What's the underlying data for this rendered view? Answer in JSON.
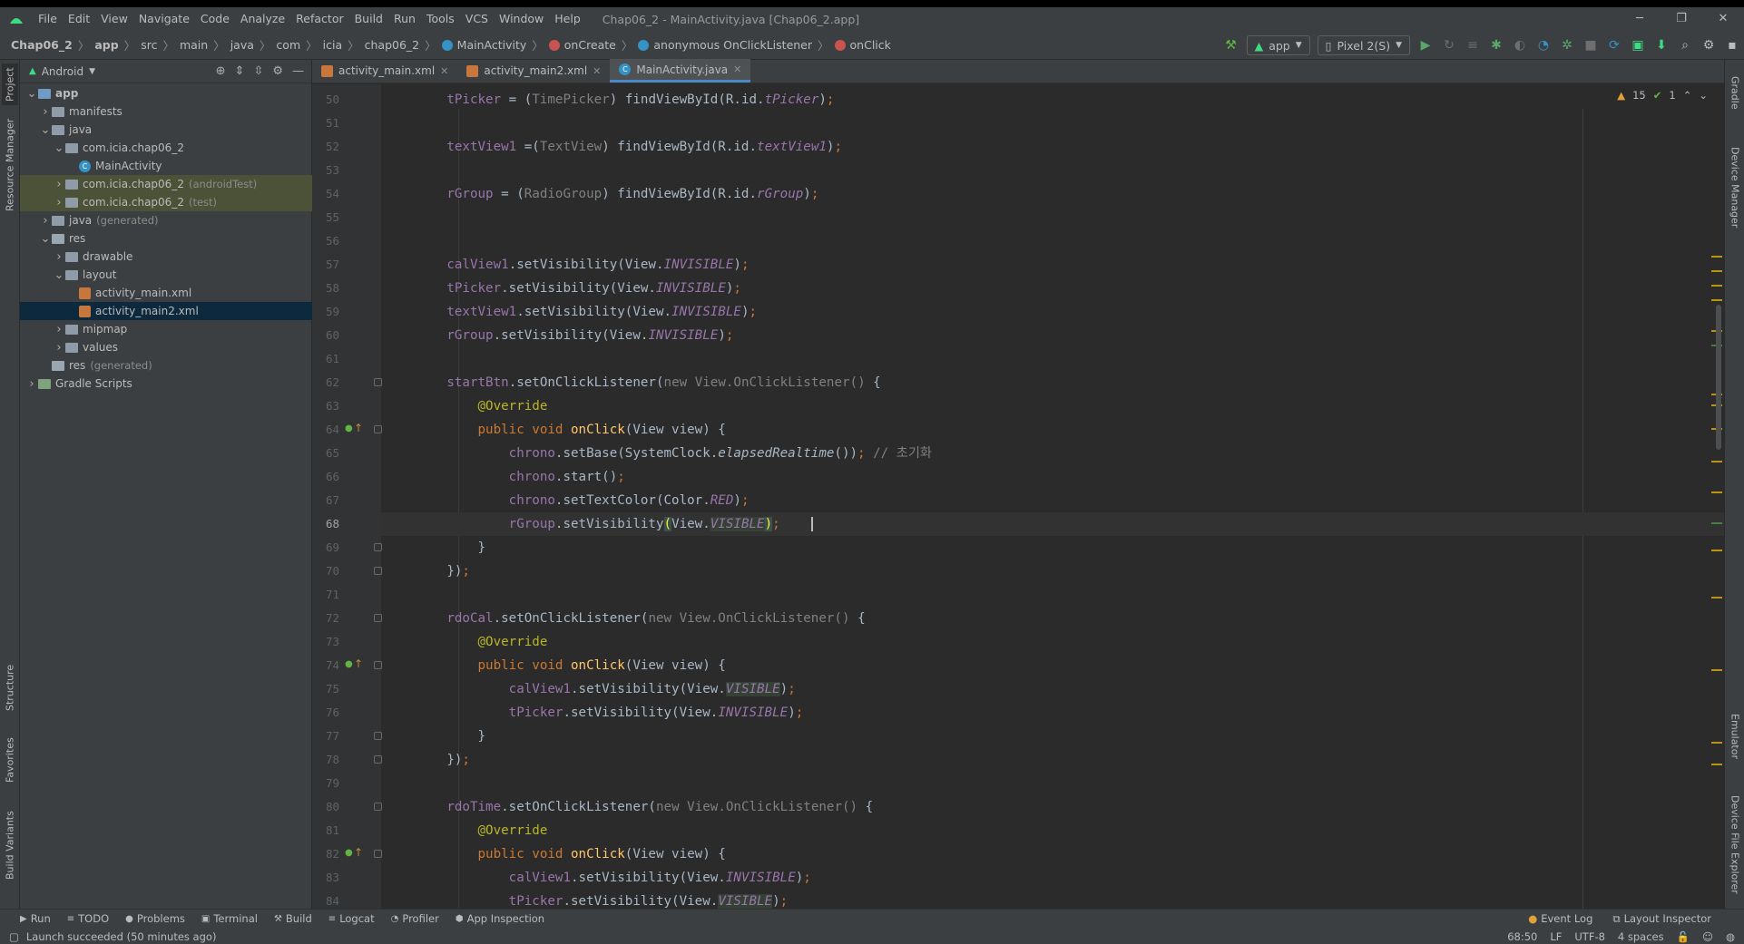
{
  "window": {
    "title": "Chap06_2 - MainActivity.java [Chap06_2.app]",
    "menu": [
      "File",
      "Edit",
      "View",
      "Navigate",
      "Code",
      "Analyze",
      "Refactor",
      "Build",
      "Run",
      "Tools",
      "VCS",
      "Window",
      "Help"
    ],
    "controls": [
      "─",
      "❐",
      "✕"
    ]
  },
  "breadcrumb": [
    "Chap06_2",
    "app",
    "src",
    "main",
    "java",
    "com",
    "icia",
    "chap06_2",
    "MainActivity",
    "onCreate",
    "anonymous OnClickListener",
    "onClick"
  ],
  "toolbar": {
    "config": "app",
    "device": "Pixel 2(S)"
  },
  "left_strip": [
    "Project",
    "Resource Manager",
    "Structure",
    "Favorites",
    "Build Variants"
  ],
  "right_strip": [
    "Gradle",
    "Device Manager",
    "Emulator",
    "Device File Explorer"
  ],
  "project_panel": {
    "view": "Android",
    "tree": [
      {
        "label": "app",
        "depth": 0,
        "arrow": "▼",
        "icon": "folder-blue",
        "bold": true
      },
      {
        "label": "manifests",
        "depth": 1,
        "arrow": "▶",
        "icon": "folder"
      },
      {
        "label": "java",
        "depth": 1,
        "arrow": "▼",
        "icon": "folder"
      },
      {
        "label": "com.icia.chap06_2",
        "depth": 2,
        "arrow": "▼",
        "icon": "folder"
      },
      {
        "label": "MainActivity",
        "depth": 3,
        "arrow": "",
        "icon": "class"
      },
      {
        "label": "com.icia.chap06_2",
        "suffix": "(androidTest)",
        "depth": 2,
        "arrow": "▶",
        "icon": "folder",
        "state": "mod"
      },
      {
        "label": "com.icia.chap06_2",
        "suffix": "(test)",
        "depth": 2,
        "arrow": "▶",
        "icon": "folder",
        "state": "mod"
      },
      {
        "label": "java",
        "suffix": "(generated)",
        "depth": 1,
        "arrow": "▶",
        "icon": "folder"
      },
      {
        "label": "res",
        "depth": 1,
        "arrow": "▼",
        "icon": "folder-res"
      },
      {
        "label": "drawable",
        "depth": 2,
        "arrow": "▶",
        "icon": "folder"
      },
      {
        "label": "layout",
        "depth": 2,
        "arrow": "▼",
        "icon": "folder"
      },
      {
        "label": "activity_main.xml",
        "depth": 3,
        "arrow": "",
        "icon": "xml"
      },
      {
        "label": "activity_main2.xml",
        "depth": 3,
        "arrow": "",
        "icon": "xml",
        "state": "sel"
      },
      {
        "label": "mipmap",
        "depth": 2,
        "arrow": "▶",
        "icon": "folder"
      },
      {
        "label": "values",
        "depth": 2,
        "arrow": "▶",
        "icon": "folder"
      },
      {
        "label": "res",
        "suffix": "(generated)",
        "depth": 1,
        "arrow": "",
        "icon": "folder-res"
      },
      {
        "label": "Gradle Scripts",
        "depth": 0,
        "arrow": "▶",
        "icon": "gradle"
      }
    ]
  },
  "tabs": [
    {
      "label": "activity_main.xml",
      "icon": "xml",
      "active": false
    },
    {
      "label": "activity_main2.xml",
      "icon": "xml",
      "active": false
    },
    {
      "label": "MainActivity.java",
      "icon": "class",
      "active": true
    }
  ],
  "inspections": {
    "warnings": "15",
    "ok": "1"
  },
  "current_line": 68,
  "code": [
    {
      "n": 50,
      "html": "        <span class='f'>tPicker</span> = (<span class='gr'>TimePicker</span>) findViewById(R.id.<span class='fi'>tPicker</span>)<span class='kw'>;</span>"
    },
    {
      "n": 51,
      "html": ""
    },
    {
      "n": 52,
      "html": "        <span class='f'>textView1</span> =(<span class='gr'>TextView</span>) findViewById(R.id.<span class='fi'>textView1</span>)<span class='kw'>;</span>"
    },
    {
      "n": 53,
      "html": ""
    },
    {
      "n": 54,
      "html": "        <span class='f'>rGroup</span> = (<span class='gr'>RadioGroup</span>) findViewById(R.id.<span class='fi'>rGroup</span>)<span class='kw'>;</span>"
    },
    {
      "n": 55,
      "html": ""
    },
    {
      "n": 56,
      "html": ""
    },
    {
      "n": 57,
      "html": "        <span class='f'>calView1</span>.setVisibility(View.<span class='fi'>INVISIBLE</span>)<span class='kw'>;</span>"
    },
    {
      "n": 58,
      "html": "        <span class='f'>tPicker</span>.setVisibility(View.<span class='fi'>INVISIBLE</span>)<span class='kw'>;</span>"
    },
    {
      "n": 59,
      "html": "        <span class='f'>textView1</span>.setVisibility(View.<span class='fi'>INVISIBLE</span>)<span class='kw'>;</span>"
    },
    {
      "n": 60,
      "html": "        <span class='f'>rGroup</span>.setVisibility(View.<span class='fi'>INVISIBLE</span>)<span class='kw'>;</span>"
    },
    {
      "n": 61,
      "html": ""
    },
    {
      "n": 62,
      "html": "        <span class='f'>startBtn</span>.setOnClickListener(<span class='gr'>new View.OnClickListener() </span>{",
      "fold": true
    },
    {
      "n": 63,
      "html": "            <span class='ann'>@Override</span>"
    },
    {
      "n": 64,
      "html": "            <span class='kw'>public void </span><span class='m'>onClick</span>(View view) {",
      "impl": true,
      "fold": true
    },
    {
      "n": 65,
      "html": "                <span class='f'>chrono</span>.setBase(SystemClock.<span class='st'>elapsedRealtime</span>())<span class='kw'>; </span><span class='gr'>// 초기화</span>"
    },
    {
      "n": 66,
      "html": "                <span class='f'>chrono</span>.start()<span class='kw'>;</span>"
    },
    {
      "n": 67,
      "html": "                <span class='f'>chrono</span>.setTextColor(Color.<span class='fi'>RED</span>)<span class='kw'>;</span>"
    },
    {
      "n": 68,
      "html": "                <span class='f'>rGroup</span>.setVisibility<span class='brace'>(</span>View.<span class='fi vis'>VISIBLE</span><span class='brace'>)</span><span class='kw'>;</span>",
      "cur": true
    },
    {
      "n": 69,
      "html": "            }",
      "fold": true
    },
    {
      "n": 70,
      "html": "        })<span class='kw'>;</span>",
      "fold": true
    },
    {
      "n": 71,
      "html": ""
    },
    {
      "n": 72,
      "html": "        <span class='f'>rdoCal</span>.setOnClickListener(<span class='gr'>new View.OnClickListener() </span>{",
      "fold": true
    },
    {
      "n": 73,
      "html": "            <span class='ann'>@Override</span>"
    },
    {
      "n": 74,
      "html": "            <span class='kw'>public void </span><span class='m'>onClick</span>(View view) {",
      "impl": true,
      "fold": true
    },
    {
      "n": 75,
      "html": "                <span class='f'>calView1</span>.setVisibility(View.<span class='fi vis'>VISIBLE</span>)<span class='kw'>;</span>"
    },
    {
      "n": 76,
      "html": "                <span class='f'>tPicker</span>.setVisibility(View.<span class='fi'>INVISIBLE</span>)<span class='kw'>;</span>"
    },
    {
      "n": 77,
      "html": "            }",
      "fold": true
    },
    {
      "n": 78,
      "html": "        })<span class='kw'>;</span>",
      "fold": true
    },
    {
      "n": 79,
      "html": ""
    },
    {
      "n": 80,
      "html": "        <span class='f'>rdoTime</span>.setOnClickListener(<span class='gr'>new View.OnClickListener() </span>{",
      "fold": true
    },
    {
      "n": 81,
      "html": "            <span class='ann'>@Override</span>"
    },
    {
      "n": 82,
      "html": "            <span class='kw'>public void </span><span class='m'>onClick</span>(View view) {",
      "impl": true,
      "fold": true
    },
    {
      "n": 83,
      "html": "                <span class='f'>calView1</span>.setVisibility(View.<span class='fi'>INVISIBLE</span>)<span class='kw'>;</span>"
    },
    {
      "n": 84,
      "html": "                <span class='f'>tPicker</span>.setVisibility(View.<span class='fi vis'>VISIBLE</span>)<span class='kw'>;</span>"
    }
  ],
  "bottom_tools": [
    "Run",
    "TODO",
    "Problems",
    "Terminal",
    "Build",
    "Logcat",
    "Profiler",
    "App Inspection"
  ],
  "bottom_tools_right": [
    "Event Log",
    "Layout Inspector"
  ],
  "status": {
    "message": "Launch succeeded (50 minutes ago)",
    "position": "68:50",
    "line_sep": "LF",
    "encoding": "UTF-8",
    "indent": "4 spaces"
  },
  "colors": {
    "accent": "#4a88c7",
    "bg": "#2b2b2b",
    "panel": "#3c3f41",
    "field": "#9876aa",
    "keyword": "#cc7832",
    "method": "#ffc66d",
    "annotation": "#bbb529"
  }
}
